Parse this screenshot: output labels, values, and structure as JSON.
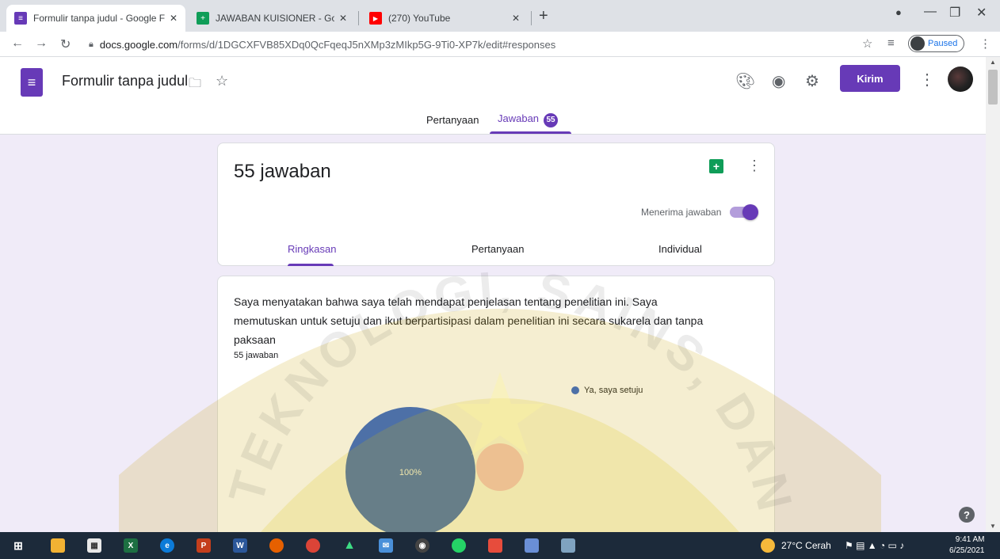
{
  "browser": {
    "tabs": [
      {
        "title": "Formulir tanpa judul - Google Fo",
        "favicon_color": "#673ab7",
        "favicon_glyph": "≡",
        "active": true
      },
      {
        "title": "JAWABAN KUISIONER - Google S",
        "favicon_color": "#0f9d58",
        "favicon_glyph": "+",
        "active": false
      },
      {
        "title": "(270) YouTube",
        "favicon_color": "#ff0000",
        "favicon_glyph": "▶",
        "active": false
      }
    ],
    "close_glyph": "✕",
    "new_tab": "+",
    "url_host": "docs.google.com",
    "url_path": "/forms/d/1DGCXFVB85XDq0QcFqeqJ5nXMp3zMIkp5G-9Ti0-XP7k/edit#responses",
    "profile_status": "Paused"
  },
  "form": {
    "title": "Formulir tanpa judul",
    "send_label": "Kirim",
    "mode_tabs": {
      "questions": "Pertanyaan",
      "responses": "Jawaban",
      "response_count": "55"
    }
  },
  "summary": {
    "responses_title": "55 jawaban",
    "accepting_label": "Menerima jawaban",
    "accepting": true,
    "tabs": {
      "summary": "Ringkasan",
      "question": "Pertanyaan",
      "individual": "Individual"
    }
  },
  "question": {
    "text": "Saya menyatakan bahwa saya telah mendapat penjelasan tentang penelitian ini. Saya memutuskan untuk setuju dan ikut berpartisipasi dalam penelitian ini secara sukarela dan tanpa paksaan",
    "count": "55 jawaban"
  },
  "chart_data": {
    "type": "pie",
    "categories": [
      "Ya, saya setuju"
    ],
    "values": [
      100
    ],
    "slice_labels": [
      "100%"
    ],
    "colors": [
      "#3366cc"
    ],
    "legend_position": "top-right"
  },
  "watermark": {
    "text": "TEKNOLOGI, SAINS, DAN KESEH"
  },
  "taskbar": {
    "weather": "27°C  Cerah",
    "time": "9:41 AM",
    "date": "6/25/2021"
  }
}
